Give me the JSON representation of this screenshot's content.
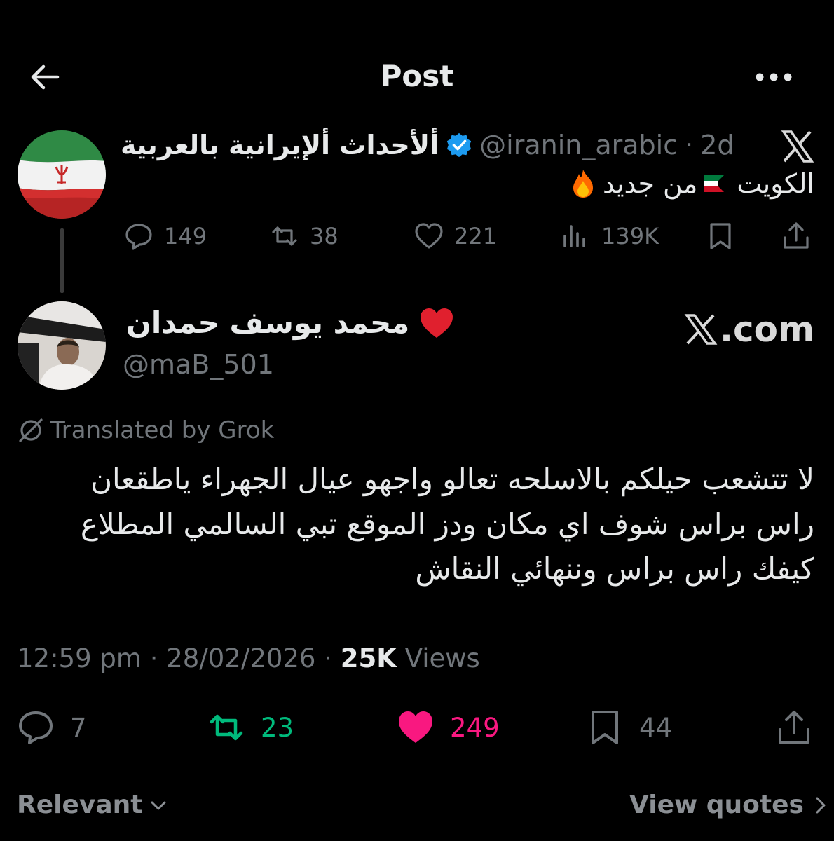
{
  "header": {
    "title": "Post",
    "back_icon": "arrow-left-icon",
    "more_icon": "more-horizontal-icon"
  },
  "parent_post": {
    "display_name": "ألأحداث ألإيرانية بالعربية",
    "handle": "@iranin_arabic",
    "separator": "·",
    "time": "2d",
    "verified_color": "#1d9bf0",
    "text_before_flag": "الكويت",
    "text_after_flag": "من جديد",
    "flag_icon": "kuwait-flag-icon",
    "emoji_icon": "fire-icon",
    "source_logo": "x-logo-icon",
    "stats": {
      "replies": "149",
      "reposts": "38",
      "likes": "221",
      "views": "139K"
    }
  },
  "main_post": {
    "display_name": "محمد يوسف حمدان",
    "name_emoji": "red-heart-icon",
    "handle": "@maB_501",
    "watermark": ".com",
    "translated_label": "Translated by Grok",
    "text_lines": [
      "لا تتشعب حيلكم بالاسلحه تعالو واجهو عيال الجهراء ياطقعان",
      "راس براس شوف اي مكان ودز الموقع تبي السالمي المطلاع",
      "كيفك راس براس وننهائي النقاش"
    ],
    "time": "12:59 pm",
    "date": "28/02/2026",
    "separator": "·",
    "views_count": "25K",
    "views_label": "Views",
    "stats": {
      "replies": "7",
      "reposts": "23",
      "likes": "249",
      "bookmarks": "44"
    },
    "colors": {
      "repost": "#00ba7c",
      "like": "#f91880",
      "muted": "#71767b"
    }
  },
  "footer": {
    "sort_label": "Relevant",
    "quotes_label": "View quotes"
  }
}
